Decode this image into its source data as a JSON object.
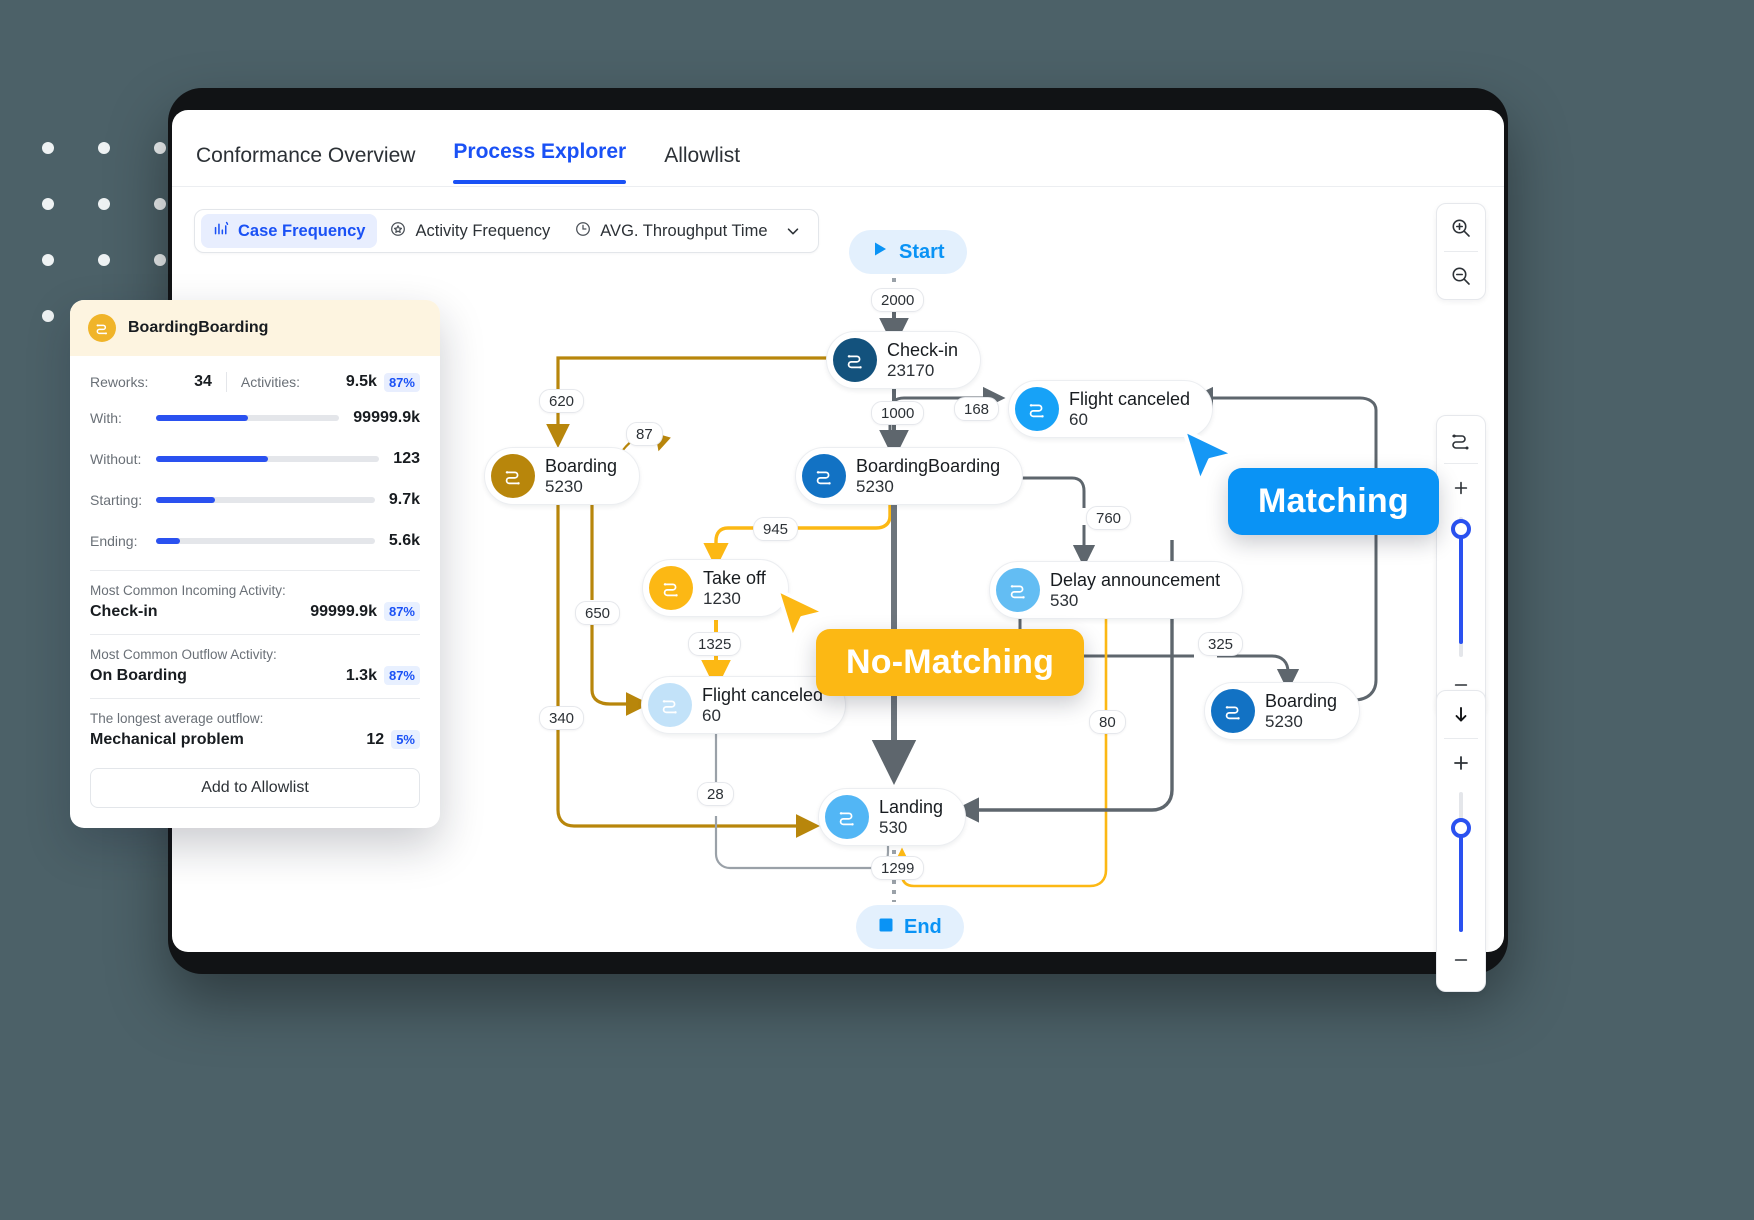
{
  "tabs": [
    {
      "label": "Conformance Overview",
      "active": false
    },
    {
      "label": "Process Explorer",
      "active": true
    },
    {
      "label": "Allowlist",
      "active": false
    }
  ],
  "metric_selector": {
    "options": [
      {
        "label": "Case Frequency",
        "icon": "bar-chart-icon",
        "active": true
      },
      {
        "label": "Activity Frequency",
        "icon": "activity-star-icon",
        "active": false
      },
      {
        "label": "AVG. Throughput Time",
        "icon": "clock-icon",
        "active": false
      }
    ],
    "caret": "chevron-down-icon"
  },
  "toolbars": {
    "zoom": [
      "zoom-in-icon",
      "zoom-out-icon"
    ],
    "flow": {
      "icon": "flow-path-icon",
      "plus": "+",
      "minus": "—"
    },
    "fit": {
      "icon": "fit-down-icon",
      "plus": "+"
    }
  },
  "panel": {
    "title": "BoardingBoarding",
    "icon": "flow-path-icon",
    "reworks_label": "Reworks:",
    "reworks_value": "34",
    "activities_label": "Activities:",
    "activities_value": "9.5k",
    "activities_badge": "87%",
    "bars": [
      {
        "label": "With:",
        "value": "99999.9k",
        "pct": 50
      },
      {
        "label": "Without:",
        "value": "123",
        "pct": 50
      },
      {
        "label": "Starting:",
        "value": "9.7k",
        "pct": 27
      },
      {
        "label": "Ending:",
        "value": "5.6k",
        "pct": 11
      }
    ],
    "sections": [
      {
        "label": "Most Common Incoming Activity:",
        "name": "Check-in",
        "value": "99999.9k",
        "badge": "87%"
      },
      {
        "label": "Most Common Outflow Activity:",
        "name": "On Boarding",
        "value": "1.3k",
        "badge": "87%"
      },
      {
        "label": "The longest average outflow:",
        "name": "Mechanical problem",
        "value": "12",
        "badge": "5%"
      }
    ],
    "button_label": "Add to Allowlist"
  },
  "callouts": [
    {
      "label": "Matching",
      "color": "#0a93f5"
    },
    {
      "label": "No-Matching",
      "color": "#fcb814"
    }
  ],
  "graph": {
    "start": {
      "label": "Start",
      "icon": "play-icon"
    },
    "end": {
      "label": "End",
      "icon": "stop-square-icon"
    },
    "nodes": [
      {
        "id": "checkin",
        "name": "Check-in",
        "count": "23170",
        "color": "#13527d"
      },
      {
        "id": "boarding-left",
        "name": "Boarding",
        "count": "5230",
        "color": "#b8860b"
      },
      {
        "id": "boardingboarding",
        "name": "BoardingBoarding",
        "count": "5230",
        "color": "#1272c4"
      },
      {
        "id": "flight-canceled-top",
        "name": "Flight canceled",
        "count": "60",
        "color": "#17a2f7"
      },
      {
        "id": "takeoff",
        "name": "Take off",
        "count": "1230",
        "color": "#fcb814"
      },
      {
        "id": "delay-announcement",
        "name": "Delay announcement",
        "count": "530",
        "color": "#63bdf3"
      },
      {
        "id": "flight-canceled-bottom",
        "name": "Flight canceled",
        "count": "60",
        "color": "#c2e2f9"
      },
      {
        "id": "boarding-right",
        "name": "Boarding",
        "count": "5230",
        "color": "#1272c4"
      },
      {
        "id": "landing",
        "name": "Landing",
        "count": "530",
        "color": "#52b6f5"
      }
    ],
    "edge_labels": [
      "2000",
      "1000",
      "620",
      "87",
      "168",
      "945",
      "760",
      "650",
      "1325",
      "325",
      "340",
      "80",
      "28",
      "1299"
    ]
  }
}
